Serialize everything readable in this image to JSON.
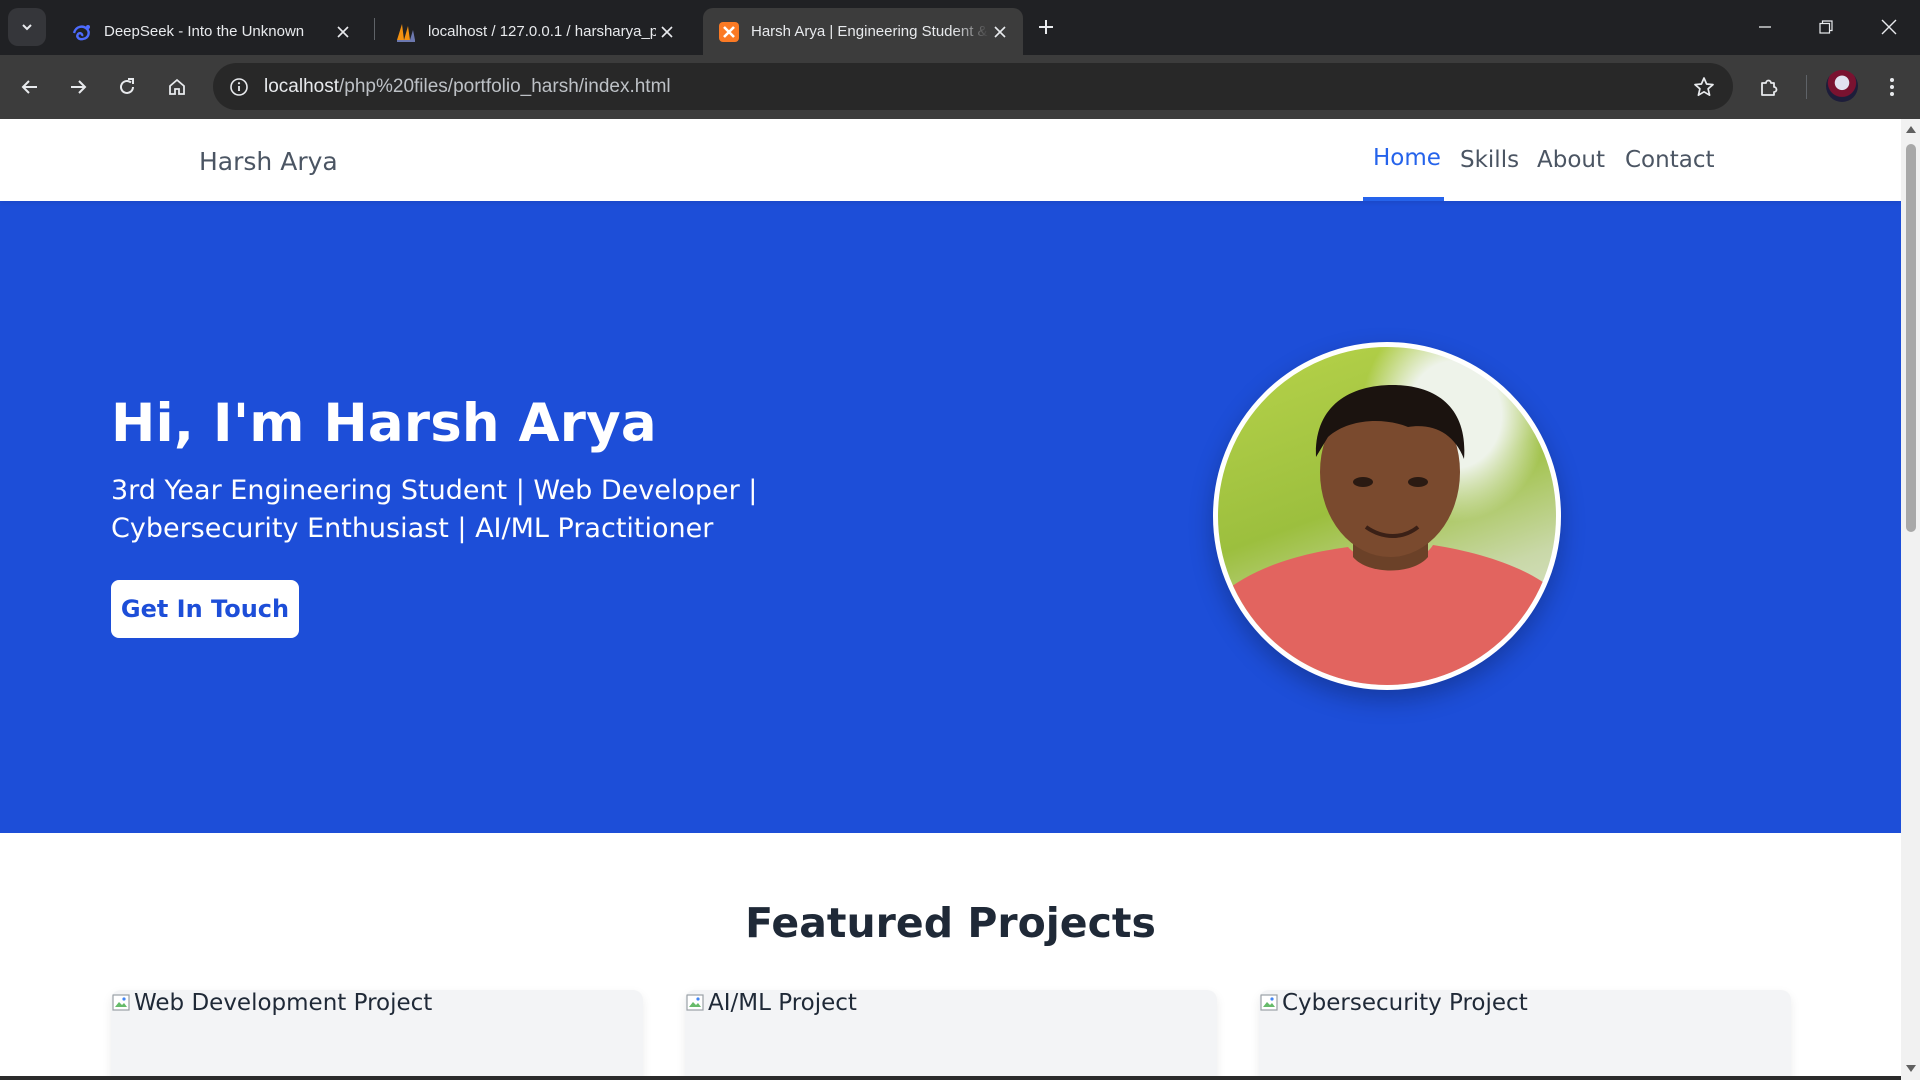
{
  "browser": {
    "tabs": [
      {
        "title": "DeepSeek - Into the Unknown",
        "icon": "deepseek-whale-icon",
        "active": false
      },
      {
        "title": "localhost / 127.0.0.1 / harsharya_p",
        "icon": "phpmyadmin-sails-icon",
        "active": false
      },
      {
        "title": "Harsh Arya | Engineering Student &",
        "icon": "xampp-icon",
        "active": true
      }
    ],
    "url_host": "localhost",
    "url_path": "/php%20files/portfolio_harsh/index.html"
  },
  "nav": {
    "brand": "Harsh Arya",
    "links": [
      "Home",
      "Skills",
      "About",
      "Contact"
    ],
    "active": "Home"
  },
  "hero": {
    "heading": "Hi, I'm Harsh Arya",
    "subtitle": "3rd Year Engineering Student | Web Developer | Cybersecurity Enthusiast | AI/ML Practitioner",
    "cta_label": "Get In Touch"
  },
  "projects": {
    "heading": "Featured Projects",
    "cards": [
      {
        "alt": "Web Development Project"
      },
      {
        "alt": "AI/ML Project"
      },
      {
        "alt": "Cybersecurity Project"
      }
    ]
  },
  "colors": {
    "hero_bg": "#1d4ed8",
    "accent": "#2563eb",
    "chrome_dark": "#202124"
  }
}
